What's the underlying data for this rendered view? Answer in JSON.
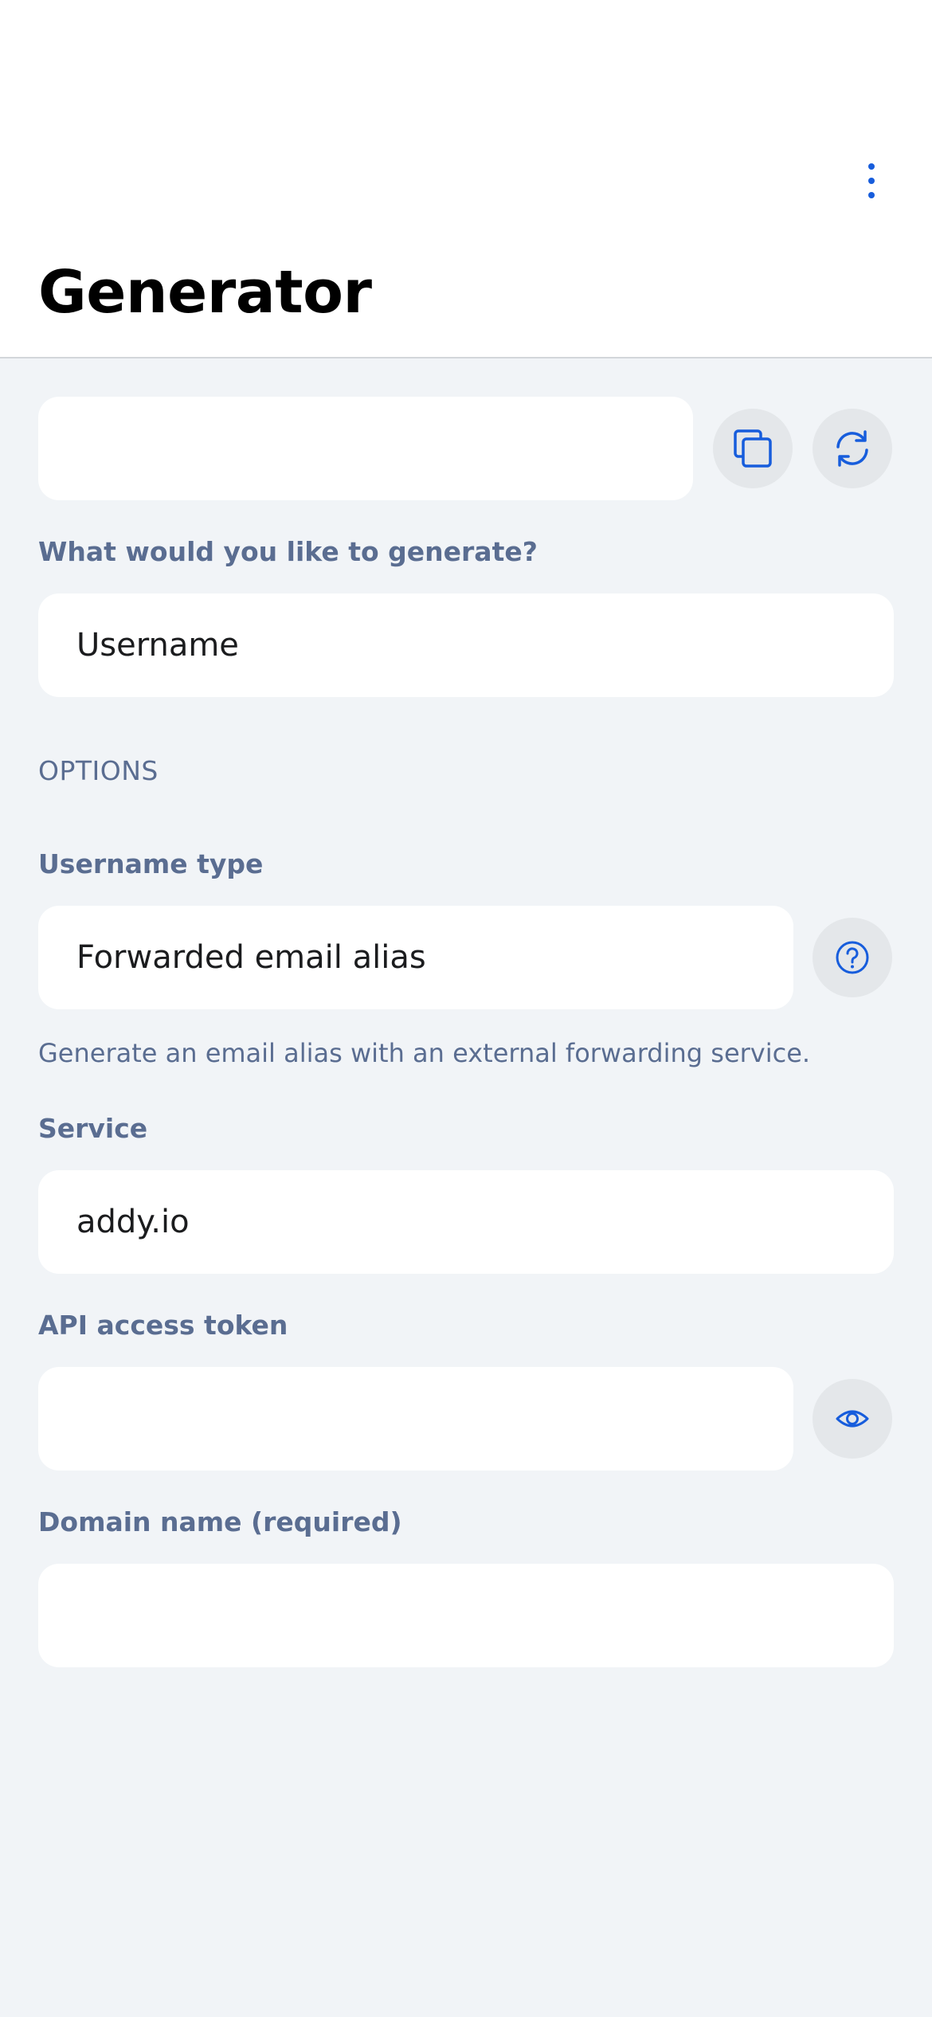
{
  "header": {
    "title": "Generator",
    "more_icon": "more-vertical-icon"
  },
  "generated": {
    "value": "",
    "copy_icon": "copy-icon",
    "regenerate_icon": "refresh-icon"
  },
  "type_select": {
    "label": "What would you like to generate?",
    "value": "Username"
  },
  "options": {
    "heading": "OPTIONS",
    "username_type": {
      "label": "Username type",
      "value": "Forwarded email alias",
      "help_icon": "help-icon",
      "helper": "Generate an email alias with an external forwarding service."
    },
    "service": {
      "label": "Service",
      "value": "addy.io"
    },
    "api_token": {
      "label": "API access token",
      "value": "",
      "visibility_icon": "eye-icon"
    },
    "domain": {
      "label": "Domain name (required)",
      "value": ""
    }
  },
  "colors": {
    "accent": "#175ddc",
    "background": "#f1f4f7",
    "label": "#5a6d91"
  }
}
